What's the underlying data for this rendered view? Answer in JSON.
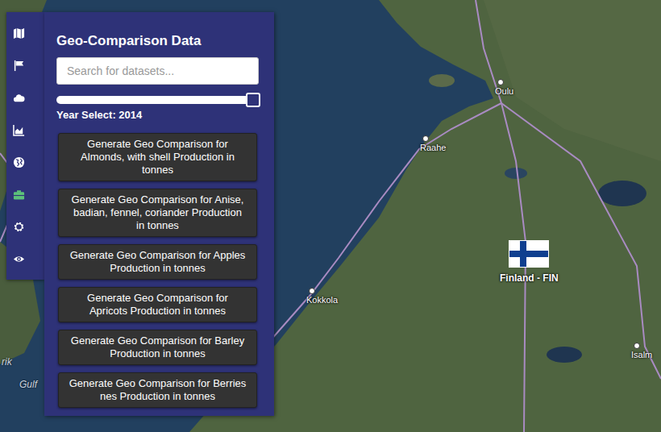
{
  "toolbar": {
    "tools": [
      {
        "selected": false
      },
      {
        "selected": false
      },
      {
        "selected": false
      },
      {
        "selected": false
      },
      {
        "selected": false
      },
      {
        "selected": true
      },
      {
        "selected": false
      },
      {
        "selected": false
      }
    ]
  },
  "panel": {
    "title": "Geo-Comparison Data",
    "search": {
      "placeholder": "Search for datasets..."
    },
    "year_slider": {
      "label": "Year Select: 2014",
      "level": 1.0
    },
    "buttons": [
      "Generate Geo Comparison for Almonds, with shell Production in tonnes",
      "Generate Geo Comparison for Anise, badian, fennel, coriander Production in tonnes",
      "Generate Geo Comparison for Apples Production in tonnes",
      "Generate Geo Comparison for Apricots Production in tonnes",
      "Generate Geo Comparison for Barley Production in tonnes",
      "Generate Geo Comparison for Berries nes Production in tonnes"
    ]
  },
  "map": {
    "places": [
      {
        "name": "Oulu"
      },
      {
        "name": "Raahe"
      },
      {
        "name": "Kokkola"
      },
      {
        "name": "Isalm"
      }
    ],
    "water_labels": [
      {
        "name": "Gulf"
      },
      {
        "name": "rik"
      }
    ],
    "country": {
      "name": "Finland - FIN"
    }
  }
}
